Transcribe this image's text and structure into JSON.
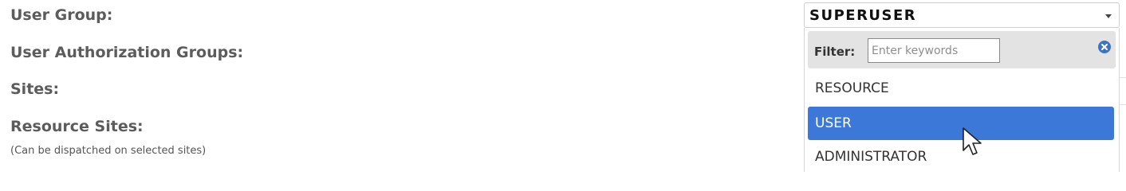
{
  "form": {
    "user_group_label": "User Group:",
    "auth_groups_label": "User Authorization Groups:",
    "sites_label": "Sites:",
    "resource_sites_label": "Resource Sites:",
    "resource_sites_hint": "(Can be dispatched on selected sites)"
  },
  "user_group_select": {
    "selected_value": "SUPERUSER",
    "arrow_icon": "caret-down-icon"
  },
  "dropdown": {
    "filter_label": "Filter:",
    "filter_value": "",
    "filter_placeholder": "Enter keywords",
    "clear_icon": "clear-circle-icon",
    "options": [
      {
        "label": "RESOURCE",
        "highlighted": false
      },
      {
        "label": "USER",
        "highlighted": true
      },
      {
        "label": "ADMINISTRATOR",
        "highlighted": false
      }
    ],
    "highlight_color": "#3b78d8"
  }
}
